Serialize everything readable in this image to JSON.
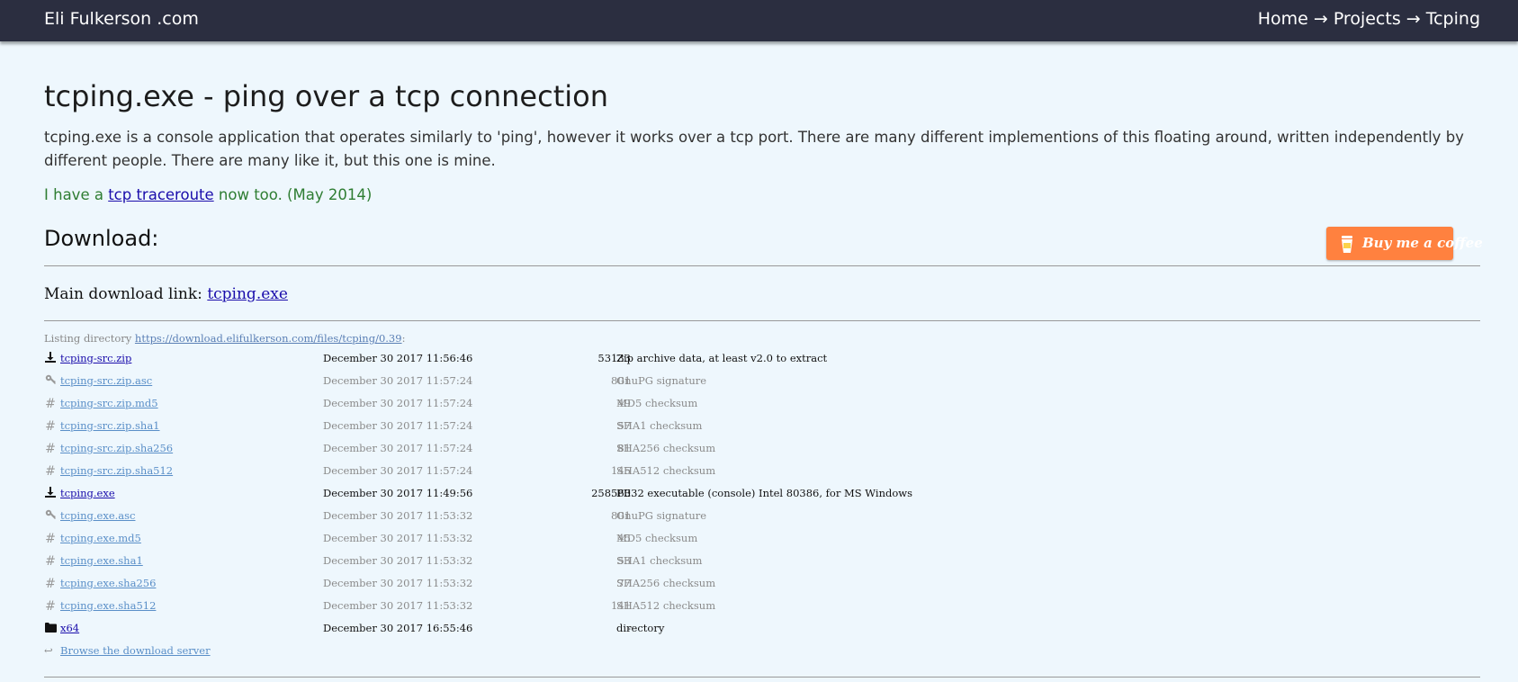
{
  "header": {
    "site_title": "Eli Fulkerson .com",
    "breadcrumb": [
      "Home",
      "Projects",
      "Tcping"
    ],
    "separator": "→"
  },
  "page": {
    "title": "tcping.exe - ping over a tcp connection",
    "intro": "tcping.exe is a console application that operates similarly to 'ping', however it works over a tcp port. There are many different implementions of this floating around, written independently by different people. There are many like it, but this one is mine.",
    "note_prefix": "I have a ",
    "note_link": "tcp traceroute",
    "note_suffix": " now too. (May 2014)",
    "download_heading": "Download:",
    "coffee_button": "Buy me a coffee",
    "main_link_label": "Main download link: ",
    "main_link_text": "tcping.exe"
  },
  "listing": {
    "prefix": "Listing directory ",
    "url": "https://download.elifulkerson.com/files/tcping/0.39",
    "suffix": ":",
    "rows": [
      {
        "icon": "download-icon",
        "name": "tcping-src.zip",
        "date": "December 30 2017 11:56:46",
        "size": "53133",
        "desc": "Zip archive data, at least v2.0 to extract",
        "style": "strong"
      },
      {
        "icon": "key-icon",
        "name": "tcping-src.zip.asc",
        "date": "December 30 2017 11:57:24",
        "size": "801",
        "desc": "GnuPG signature",
        "style": "dim"
      },
      {
        "icon": "hash-icon",
        "name": "tcping-src.zip.md5",
        "date": "December 30 2017 11:57:24",
        "size": "49",
        "desc": "MD5 checksum",
        "style": "dim"
      },
      {
        "icon": "hash-icon",
        "name": "tcping-src.zip.sha1",
        "date": "December 30 2017 11:57:24",
        "size": "57",
        "desc": "SHA1 checksum",
        "style": "dim"
      },
      {
        "icon": "hash-icon",
        "name": "tcping-src.zip.sha256",
        "date": "December 30 2017 11:57:24",
        "size": "81",
        "desc": "SHA256 checksum",
        "style": "dim"
      },
      {
        "icon": "hash-icon",
        "name": "tcping-src.zip.sha512",
        "date": "December 30 2017 11:57:24",
        "size": "145",
        "desc": "SHA512 checksum",
        "style": "dim"
      },
      {
        "icon": "download-icon",
        "name": "tcping.exe",
        "date": "December 30 2017 11:49:56",
        "size": "258560",
        "desc": "PE32 executable (console) Intel 80386, for MS Windows",
        "style": "strong"
      },
      {
        "icon": "key-icon",
        "name": "tcping.exe.asc",
        "date": "December 30 2017 11:53:32",
        "size": "801",
        "desc": "GnuPG signature",
        "style": "dim"
      },
      {
        "icon": "hash-icon",
        "name": "tcping.exe.md5",
        "date": "December 30 2017 11:53:32",
        "size": "45",
        "desc": "MD5 checksum",
        "style": "dim"
      },
      {
        "icon": "hash-icon",
        "name": "tcping.exe.sha1",
        "date": "December 30 2017 11:53:32",
        "size": "53",
        "desc": "SHA1 checksum",
        "style": "dim"
      },
      {
        "icon": "hash-icon",
        "name": "tcping.exe.sha256",
        "date": "December 30 2017 11:53:32",
        "size": "77",
        "desc": "SHA256 checksum",
        "style": "dim"
      },
      {
        "icon": "hash-icon",
        "name": "tcping.exe.sha512",
        "date": "December 30 2017 11:53:32",
        "size": "141",
        "desc": "SHA512 checksum",
        "style": "dim"
      },
      {
        "icon": "folder-icon",
        "name": "x64",
        "date": "December 30 2017 16:55:46",
        "size": "-",
        "desc": "directory",
        "style": "strong"
      }
    ],
    "browse_icon": "return-arrow-icon",
    "browse_text": "Browse the download server"
  },
  "colors": {
    "topbar": "#2b2e40",
    "background": "#eef7fd",
    "note_green": "#2e7d32",
    "coffee_orange": "#ff813f"
  }
}
